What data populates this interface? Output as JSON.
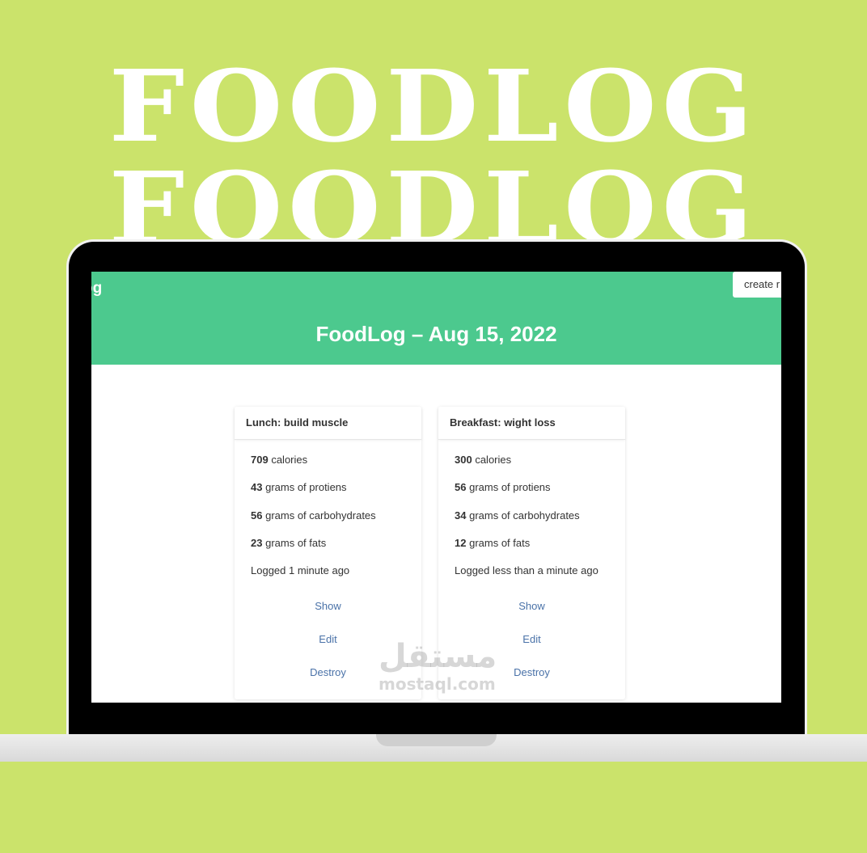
{
  "hero": {
    "line1": "FOODLOG",
    "line2": "FOODLOG"
  },
  "app": {
    "brand": "og",
    "create_button": "create r",
    "page_title": "FoodLog – Aug 15, 2022"
  },
  "cards": [
    {
      "title": "Lunch: build muscle",
      "stats": [
        {
          "value": "709",
          "label": "calories"
        },
        {
          "value": "43",
          "label": "grams of protiens"
        },
        {
          "value": "56",
          "label": "grams of carbohydrates"
        },
        {
          "value": "23",
          "label": "grams of fats"
        }
      ],
      "logged": "Logged 1 minute ago",
      "actions": [
        "Show",
        "Edit",
        "Destroy"
      ]
    },
    {
      "title": "Breakfast: wight loss",
      "stats": [
        {
          "value": "300",
          "label": "calories"
        },
        {
          "value": "56",
          "label": "grams of protiens"
        },
        {
          "value": "34",
          "label": "grams of carbohydrates"
        },
        {
          "value": "12",
          "label": "grams of fats"
        }
      ],
      "logged": "Logged less than a minute ago",
      "actions": [
        "Show",
        "Edit",
        "Destroy"
      ]
    }
  ],
  "watermark": {
    "arabic": "مستقل",
    "latin": "mostaql.com"
  },
  "colors": {
    "background": "#cbe36b",
    "navbar": "#4cc98e",
    "link": "#4a72a8"
  }
}
